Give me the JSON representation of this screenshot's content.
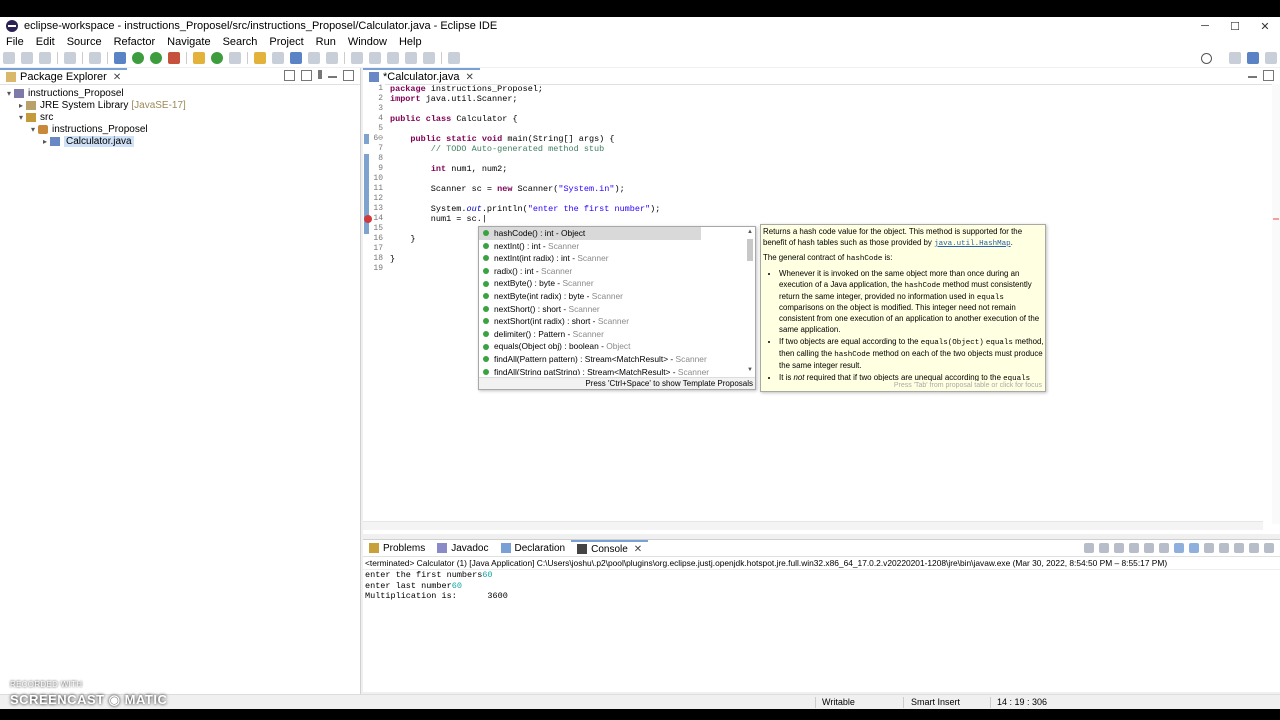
{
  "window": {
    "title": "eclipse-workspace - instructions_Proposel/src/instructions_Proposel/Calculator.java - Eclipse IDE",
    "minimize": "─",
    "maximize": "☐",
    "close": "✕"
  },
  "menu": [
    "File",
    "Edit",
    "Source",
    "Refactor",
    "Navigate",
    "Search",
    "Project",
    "Run",
    "Window",
    "Help"
  ],
  "explorer": {
    "tab_label": "Package Explorer",
    "tree": [
      {
        "label": "instructions_Proposel",
        "extra": "",
        "level": 0,
        "twisty": "▾"
      },
      {
        "label": "JRE System Library",
        "extra": "[JavaSE-17]",
        "level": 1,
        "twisty": "▸"
      },
      {
        "label": "src",
        "extra": "",
        "level": 1,
        "twisty": "▾"
      },
      {
        "label": "instructions_Proposel",
        "extra": "",
        "level": 2,
        "twisty": "▾"
      },
      {
        "label": "Calculator.java",
        "extra": "",
        "level": 3,
        "twisty": "▸"
      }
    ]
  },
  "editor": {
    "tab_label": "*Calculator.java",
    "lines": [
      {
        "n": "1",
        "code": "package instructions_Proposel;"
      },
      {
        "n": "2",
        "code": "import java.util.Scanner;"
      },
      {
        "n": "3",
        "code": ""
      },
      {
        "n": "4",
        "code": "public class Calculator {"
      },
      {
        "n": "5",
        "code": ""
      },
      {
        "n": "6⊖",
        "code": "    public static void main(String[] args) {"
      },
      {
        "n": "7",
        "code": "        // TODO Auto-generated method stub"
      },
      {
        "n": "8",
        "code": ""
      },
      {
        "n": "9",
        "code": "        int num1, num2;"
      },
      {
        "n": "10",
        "code": ""
      },
      {
        "n": "11",
        "code": "        Scanner sc = new Scanner(\"System.in\");"
      },
      {
        "n": "12",
        "code": ""
      },
      {
        "n": "13",
        "code": "        System.out.println(\"enter the first number\");"
      },
      {
        "n": "14",
        "code": "        num1 = sc."
      },
      {
        "n": "15",
        "code": ""
      },
      {
        "n": "16",
        "code": "    }"
      },
      {
        "n": "17",
        "code": ""
      },
      {
        "n": "18",
        "code": "}"
      },
      {
        "n": "19",
        "code": ""
      }
    ]
  },
  "assist": {
    "proposals": [
      {
        "sig": "hashCode() : int",
        "owner": "Object"
      },
      {
        "sig": "nextInt() : int",
        "owner": "Scanner"
      },
      {
        "sig": "nextInt(int radix) : int",
        "owner": "Scanner"
      },
      {
        "sig": "radix() : int",
        "owner": "Scanner"
      },
      {
        "sig": "nextByte() : byte",
        "owner": "Scanner"
      },
      {
        "sig": "nextByte(int radix) : byte",
        "owner": "Scanner"
      },
      {
        "sig": "nextShort() : short",
        "owner": "Scanner"
      },
      {
        "sig": "nextShort(int radix) : short",
        "owner": "Scanner"
      },
      {
        "sig": "delimiter() : Pattern",
        "owner": "Scanner"
      },
      {
        "sig": "equals(Object obj) : boolean",
        "owner": "Object"
      },
      {
        "sig": "findAll(Pattern pattern) : Stream<MatchResult>",
        "owner": "Scanner"
      },
      {
        "sig": "findAll(String patString) : Stream<MatchResult>",
        "owner": "Scanner"
      }
    ],
    "footer": "Press 'Ctrl+Space' to show Template Proposals"
  },
  "doc": {
    "p1a": "Returns a hash code value for the object. This method is supported for the benefit of hash tables such as those provided by ",
    "p1link": "java.util.HashMap",
    "p1b": ".",
    "p2a": "The general contract of ",
    "p2code": "hashCode",
    "p2b": " is:",
    "li1a": "Whenever it is invoked on the same object more than once during an execution of a Java application, the ",
    "li1code": "hashCode",
    "li1b": " method must consistently return the same integer, provided no information used in ",
    "li1code2": "equals",
    "li1c": " comparisons on the object is modified. This integer need not remain consistent from one execution of an application to another execution of the same application.",
    "li2a": "If two objects are equal according to the ",
    "li2code": "equals(Object)",
    "li2b": " ",
    "li2code2": "equals",
    "li2c": " method, then calling the ",
    "li2code3": "hashCode",
    "li2d": " method on each of the two objects must produce the same integer result.",
    "li3a": "It is ",
    "li3em": "not",
    "li3b": " required that if two objects are unequal according to the ",
    "li3code": "equals",
    "footer": "Press 'Tab' from proposal table or click for focus"
  },
  "console": {
    "tabs": [
      "Problems",
      "Javadoc",
      "Declaration",
      "Console"
    ],
    "terminated": "<terminated> Calculator (1) [Java Application] C:\\Users\\joshu\\.p2\\pool\\plugins\\org.eclipse.justj.openjdk.hotspot.jre.full.win32.x86_64_17.0.2.v20220201-1208\\jre\\bin\\javaw.exe  (Mar 30, 2022, 8:54:50 PM – 8:55:17 PM)",
    "out1": "enter the first numbers",
    "in1": "60",
    "out2": "enter last number",
    "in2": "60",
    "out3": "Multiplication is:      3600"
  },
  "status": {
    "writable": "Writable",
    "insert": "Smart Insert",
    "position": "14 : 19 : 306"
  },
  "watermark": {
    "top": "RECORDED WITH",
    "main": "SCREENCAST ◉ MATIC"
  }
}
